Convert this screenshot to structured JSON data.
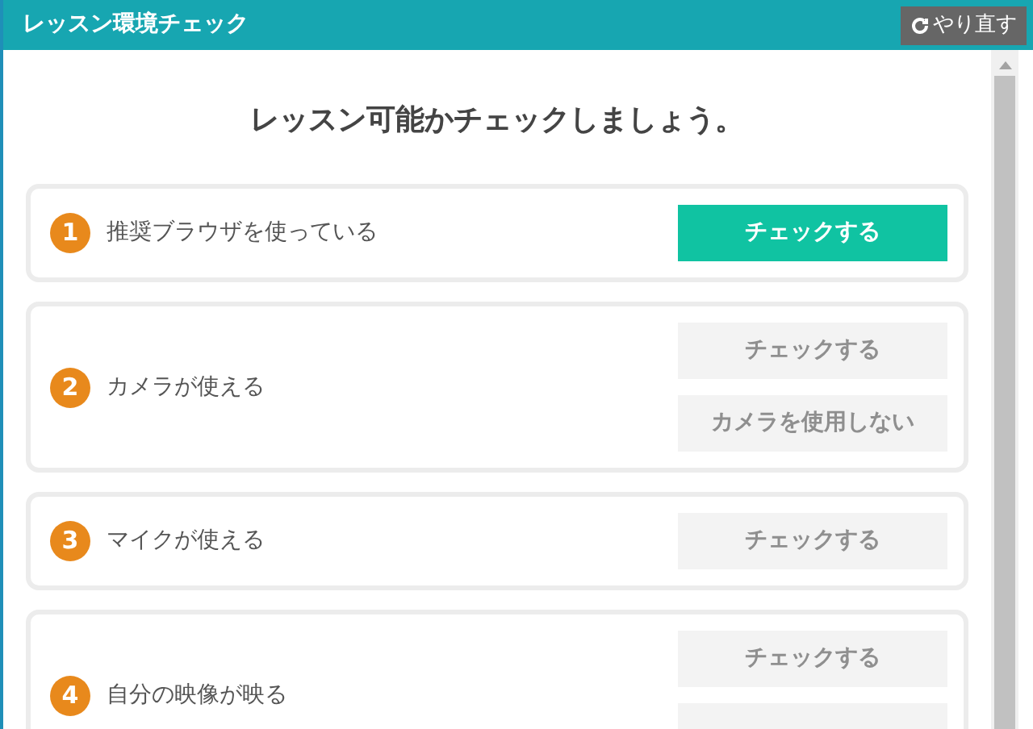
{
  "window": {
    "title": "レッスン環境チェック"
  },
  "redo_button": {
    "label": "やり直す"
  },
  "heading": "レッスン可能かチェックしましょう。",
  "steps": [
    {
      "number": "1",
      "label": "推奨ブラウザを使っている",
      "buttons": [
        {
          "label": "チェックする",
          "disabled": false
        }
      ]
    },
    {
      "number": "2",
      "label": "カメラが使える",
      "buttons": [
        {
          "label": "チェックする",
          "disabled": true
        },
        {
          "label": "カメラを使用しない",
          "disabled": true
        }
      ]
    },
    {
      "number": "3",
      "label": "マイクが使える",
      "buttons": [
        {
          "label": "チェックする",
          "disabled": true
        }
      ]
    },
    {
      "number": "4",
      "label": "自分の映像が映る",
      "buttons": [
        {
          "label": "チェックする",
          "disabled": true
        },
        {
          "disabled": true
        }
      ]
    }
  ]
}
